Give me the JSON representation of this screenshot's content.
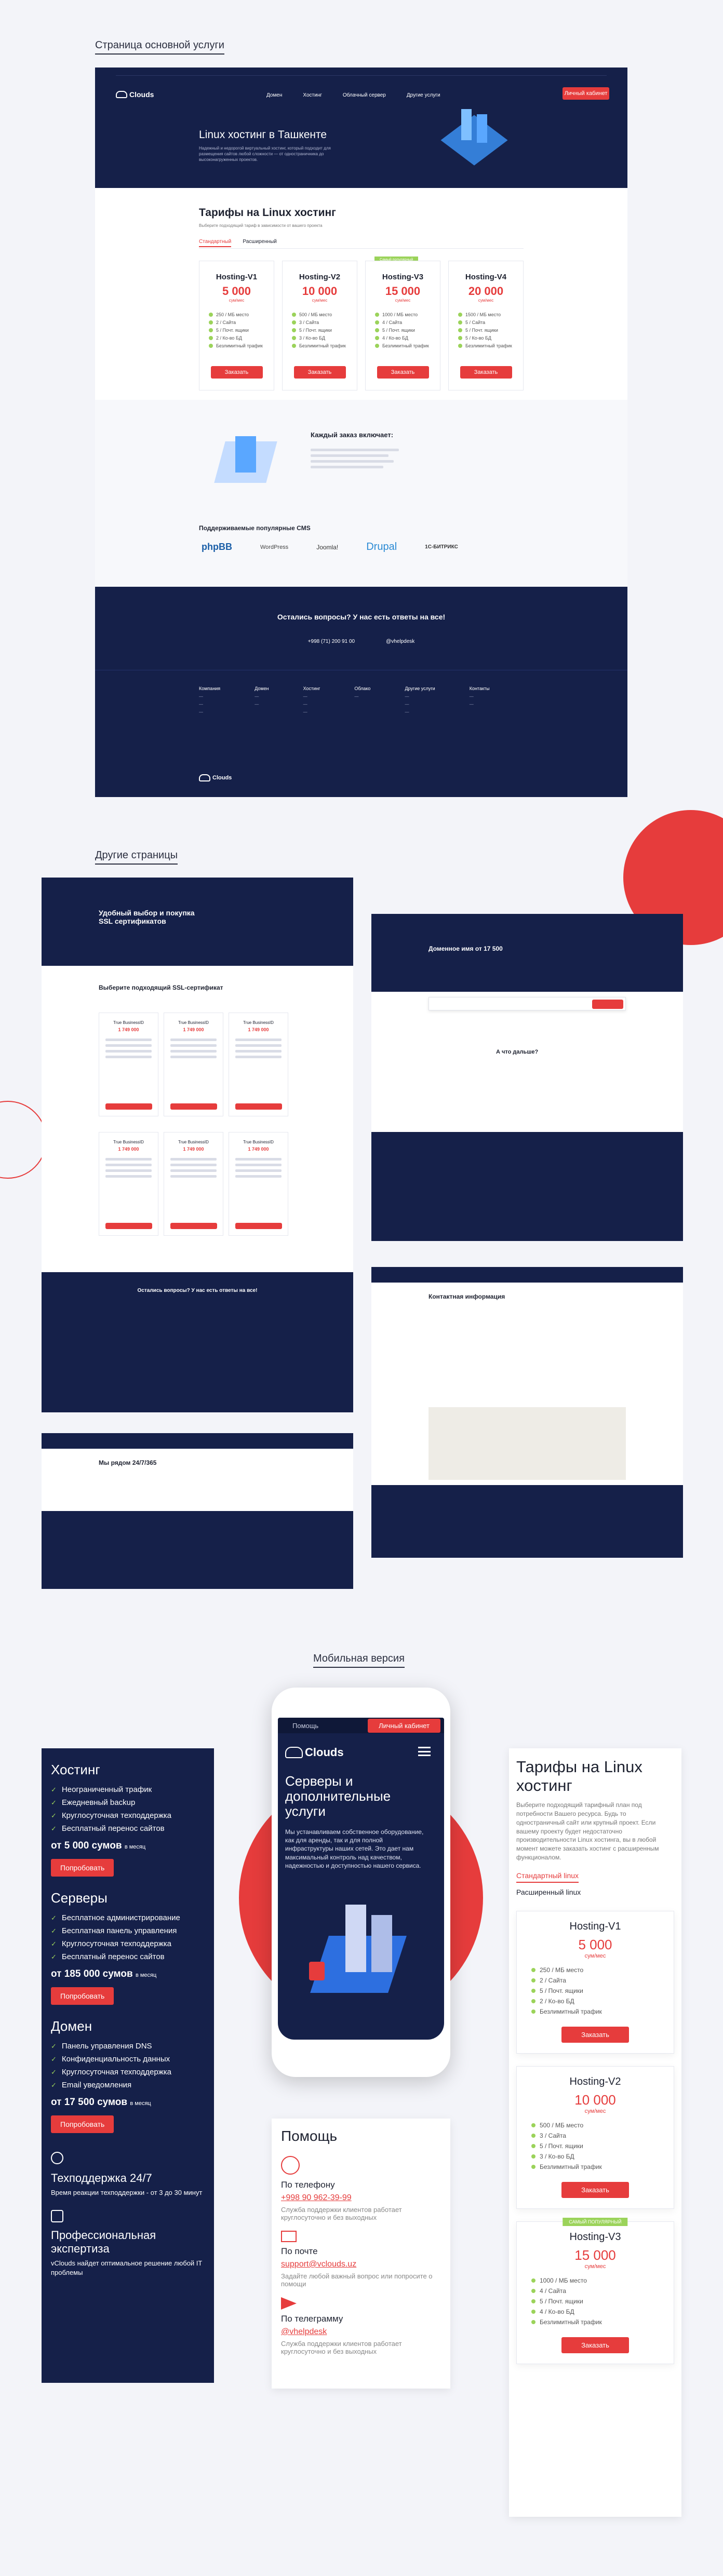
{
  "sections": {
    "main_label": "Страница основной услуги",
    "other_label": "Другие страницы",
    "mobile_label": "Мобильная версия"
  },
  "colors": {
    "accent": "#e63c3c",
    "dark": "#152049",
    "check": "#9bd35a"
  },
  "main": {
    "brand": "Clouds",
    "nav": [
      "Домен",
      "Хостинг",
      "Облачный сервер",
      "Другие услуги"
    ],
    "cta": "Личный кабинет",
    "hero_title": "Linux хостинг в Ташкенте",
    "hero_text": "Надежный и недорогой виртуальный хостинг, который подходит для размещения сайтов любой сложности — от одностраничника до высоконагруженных проектов.",
    "tariffs_title": "Тарифы на Linux хостинг",
    "tariffs_text": "Выберите подходящий тариф в зависимости от вашего проекта",
    "tabs": [
      "Стандартный",
      "Расширенный"
    ],
    "popular_badge": "Самый популярный",
    "per_month": "сум/мес",
    "order": "Заказать",
    "plans": [
      {
        "name": "Hosting-V1",
        "price": "5 000",
        "features": [
          "250 / МБ место",
          "2 / Сайта",
          "5 / Почт. ящики",
          "2 / Ко-во БД",
          "Безлимитный трафик"
        ]
      },
      {
        "name": "Hosting-V2",
        "price": "10 000",
        "features": [
          "500 / МБ место",
          "3 / Сайта",
          "5 / Почт. ящики",
          "3 / Ко-во БД",
          "Безлимитный трафик"
        ]
      },
      {
        "name": "Hosting-V3",
        "price": "15 000",
        "features": [
          "1000 / МБ место",
          "4 / Сайта",
          "5 / Почт. ящики",
          "4 / Ко-во БД",
          "Безлимитный трафик"
        ]
      },
      {
        "name": "Hosting-V4",
        "price": "20 000",
        "features": [
          "1500 / МБ место",
          "5 / Сайта",
          "5 / Почт. ящики",
          "5 / Ко-во БД",
          "Безлимитный трафик"
        ]
      }
    ],
    "includes_title": "Каждый заказ включает:",
    "cms_title": "Поддерживаемые популярные CMS",
    "cms": [
      "phpBB",
      "WordPress",
      "Joomla!",
      "Drupal",
      "1С-БИТРИКС"
    ],
    "contact_title": "Остались вопросы? У нас есть ответы на все!",
    "phone": "+998 (71) 200 91 00",
    "telegram": "@vhelpdesk",
    "footer_cols": [
      "Компания",
      "Домен",
      "Хостинг",
      "Облако",
      "Другие услуги",
      "Контакты"
    ]
  },
  "other": {
    "ssl_title": "Удобный выбор и покупка SSL сертификатов",
    "ssl_choose": "Выберите подходящий SSL-сертификат",
    "ssl_price": "1 749 000",
    "ssl_product": "True BusinessID",
    "domain_title": "Доменное имя от 17 500",
    "domain_next": "А что дальше?",
    "contact_title": "Контактная информация",
    "support_title": "Мы рядом 24/7/365",
    "questions": "Остались вопросы? У нас есть ответы на все!"
  },
  "mobile": {
    "left": [
      {
        "title": "Хостинг",
        "items": [
          "Неограниченный трафик",
          "Ежедневный backup",
          "Круглосуточная техподдержка",
          "Бесплатный перенос сайтов"
        ],
        "price": "от 5 000 сумов",
        "per": "в месяц"
      },
      {
        "title": "Серверы",
        "items": [
          "Бесплатное администрирование",
          "Бесплатная панель управления",
          "Круглосуточная техподдержка",
          "Бесплатный перенос сайтов"
        ],
        "price": "от 185 000 сумов",
        "per": "в месяц"
      },
      {
        "title": "Домен",
        "items": [
          "Панель управления DNS",
          "Конфиденциальность данных",
          "Круглосуточная техподдержка",
          "Email уведомления"
        ],
        "price": "от 17 500 сумов",
        "per": "в месяц"
      }
    ],
    "try": "Попробовать",
    "support_title": "Техподдержка 24/7",
    "support_text": "Время реакции техподдержки - от 3 до 30 минут",
    "expert_title": "Профессиональная экспертиза",
    "expert_text": "vClouds найдет оптимальное решение любой IT проблемы",
    "phone_screen": {
      "help": "Помощь",
      "cabinet": "Личный кабинет",
      "brand": "Clouds",
      "title": "Серверы и дополнительные услуги",
      "text": "Мы устанавливаем собственное оборудование, как для аренды, так и для полной инфраструктуры наших сетей. Это дает нам максимальный контроль над качеством, надежностью и доступностью нашего сервиса."
    },
    "help": {
      "title": "Помощь",
      "phone_h": "По телефону",
      "phone": "+998 90 962-39-99",
      "phone_t": "Служба поддержки клиентов работает круглосуточно и без выходных",
      "mail_h": "По почте",
      "mail": "support@vclouds.uz",
      "mail_t": "Задайте любой важный вопрос или попросите о помощи",
      "tg_h": "По телеграмму",
      "tg": "@vhelpdesk",
      "tg_t": "Служба поддержки клиентов работает круглосуточно и без выходных"
    },
    "right": {
      "title": "Тарифы на Linux хостинг",
      "text": "Выберите подходящий тарифный план под потребности Вашего ресурса. Будь то одностраничный сайт или крупный проект. Если вашему проекту будет недостаточно производительности Linux хостинга, вы в любой момент можете заказать хостинг с расширенным функционалом.",
      "tab1": "Стандартный linux",
      "tab2": "Расширенный linux",
      "badge": "САМЫЙ ПОПУЛЯРНЫЙ",
      "per": "сум/мес",
      "order": "Заказать",
      "plans": [
        {
          "name": "Hosting-V1",
          "price": "5 000",
          "f": [
            "250 / МБ место",
            "2 / Сайта",
            "5 / Почт. ящики",
            "2 / Ко-во БД",
            "Безлимитный трафик"
          ]
        },
        {
          "name": "Hosting-V2",
          "price": "10 000",
          "f": [
            "500 / МБ место",
            "3 / Сайта",
            "5 / Почт. ящики",
            "3 / Ко-во БД",
            "Безлимитный трафик"
          ]
        },
        {
          "name": "Hosting-V3",
          "price": "15 000",
          "f": [
            "1000 / МБ место",
            "4 / Сайта",
            "5 / Почт. ящики",
            "4 / Ко-во БД",
            "Безлимитный трафик"
          ]
        }
      ]
    }
  }
}
